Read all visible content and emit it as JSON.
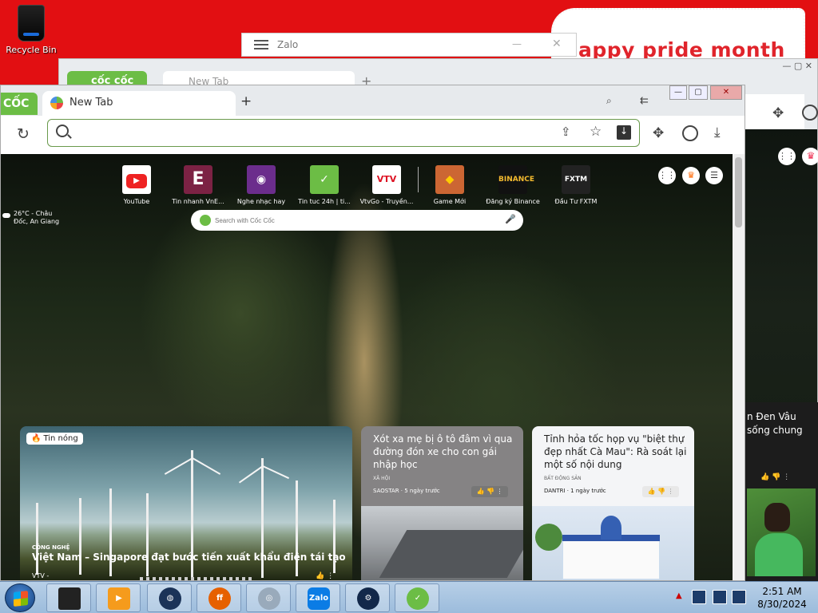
{
  "desktop": {
    "recycle_bin": "Recycle Bin",
    "pride_banner": "appy pride month"
  },
  "zalo_window": {
    "title": "Zalo",
    "minimize": "—",
    "close": "✕"
  },
  "background_browser": {
    "logo": "cốc cốc",
    "tab_title": "New Tab",
    "card_text": "n Đen Vâu sống chung"
  },
  "browser": {
    "logo": "CỐC",
    "tab_title": "New Tab",
    "new_tab": "+",
    "window_controls": {
      "minimize": "—",
      "maximize": "▢",
      "close": "✕"
    },
    "address_value": "",
    "weather": {
      "temp": "26°C - Châu",
      "place": "Đốc, An Giang"
    },
    "shortcuts": [
      {
        "label": "YouTube",
        "icon": "▶"
      },
      {
        "label": "Tin nhanh VnE...",
        "icon": "E"
      },
      {
        "label": "Nghe nhạc hay ...",
        "icon": "◉"
      },
      {
        "label": "Tin tuc 24h | ti...",
        "icon": "✓"
      },
      {
        "label": "VtvGo - Truyền...",
        "icon": "VTV"
      },
      {
        "label": "Game Mới",
        "icon": "◆"
      },
      {
        "label": "Đăng ký Binance",
        "icon": "BINANCE"
      },
      {
        "label": "Đầu Tư FXTM",
        "icon": "FXTM"
      }
    ],
    "search_placeholder": "Search with Cốc Cốc",
    "news": [
      {
        "badge": "Tin nóng",
        "category": "CÔNG NGHỆ",
        "title": "Việt Nam – Singapore đạt bước tiến xuất khẩu điện tái tạo",
        "source": "VTV -"
      },
      {
        "title": "Xót xa mẹ bị ô tô đâm vì qua đường đón xe cho con gái nhập học",
        "category": "XÃ HỘI",
        "source": "SAOSTAR · 5 ngày trước"
      },
      {
        "title": "Tỉnh hỏa tốc họp vụ \"biệt thự đẹp nhất Cà Mau\": Rà soát lại một số nội dung",
        "category": "BẤT ĐỘNG SẢN",
        "source": "DANTRI · 1 ngày trước"
      }
    ]
  },
  "taskbar": {
    "apps": [
      "app-black",
      "media-player",
      "globe",
      "firefox",
      "dvd",
      "Zalo",
      "steam",
      "coccoc"
    ],
    "time": "2:51 AM",
    "date": "8/30/2024"
  },
  "colors": {
    "desktop": "#e20f12",
    "coccoc_green": "#6cbd45",
    "taskbar": "#a9c6e2"
  }
}
